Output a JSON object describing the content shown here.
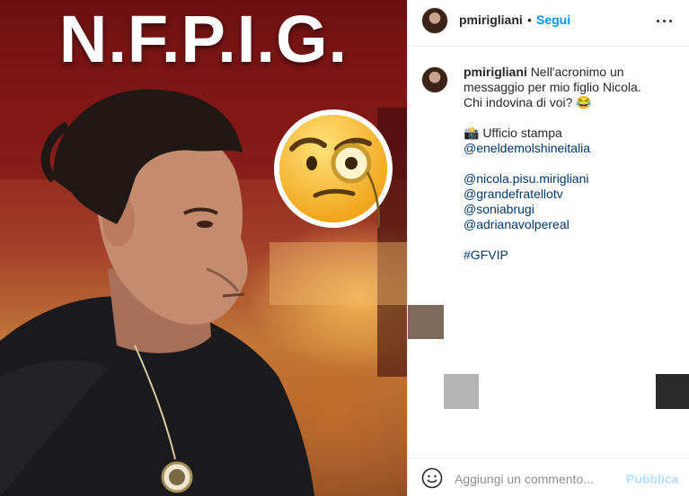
{
  "post": {
    "image_title": "N.F.P.I.G."
  },
  "header": {
    "username": "pmirigliani",
    "separator": "•",
    "follow_label": "Segui"
  },
  "caption": {
    "username": "pmirigliani",
    "lines": [
      "Nell'acronimo un",
      "messaggio per mio figlio Nicola.",
      "Chi indovina di voi? 😂"
    ],
    "credit_label": "📸 Ufficio stampa",
    "credit_tag": "@eneldemolshineitalia",
    "mentions": [
      "@nicola.pisu.mirigliani",
      "@grandefratellotv",
      "@soniabrugi",
      "@adrianavolpereal"
    ],
    "hashtag": "#GFVIP"
  },
  "comment_bar": {
    "placeholder": "Aggiungi un commento...",
    "publish_label": "Pubblica"
  },
  "colors": {
    "accent": "#0095f6",
    "link": "#00376b",
    "publish_disabled": "#b2dffc",
    "text": "#262626",
    "muted": "#8e8e8e"
  }
}
